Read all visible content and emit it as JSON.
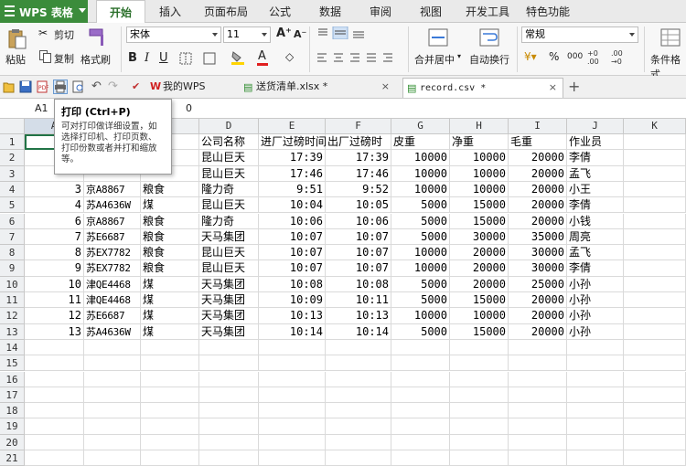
{
  "app": {
    "title": "WPS 表格"
  },
  "menu": [
    "开始",
    "插入",
    "页面布局",
    "公式",
    "数据",
    "审阅",
    "视图",
    "开发工具",
    "特色功能"
  ],
  "ribbon": {
    "paste": "粘贴",
    "cut": "剪切",
    "copy": "复制",
    "format_painter": "格式刷",
    "font_name": "宋体",
    "font_size": "11",
    "merge_center": "合并居中",
    "wrap_text": "自动换行",
    "number_format": "常规",
    "conditional_format": "条件格式",
    "bold": "B",
    "italic": "I",
    "underline": "U",
    "percent": "%",
    "comma": "000",
    "increase_font": "A⁺",
    "decrease_font": "A⁻"
  },
  "doc_tabs": [
    {
      "label": "我的WPS",
      "active": false
    },
    {
      "label": "送货清单.xlsx *",
      "active": false
    },
    {
      "label": "record.csv *",
      "active": true
    }
  ],
  "formula_bar": {
    "cell_ref": "A1",
    "value": "0"
  },
  "tooltip": {
    "title": "打印 (Ctrl+P)",
    "body": "可对打印做详细设置，如选择打印机、打印页数、打印份数或者并打和缩放等。"
  },
  "columns": [
    "A",
    "B",
    "C",
    "D",
    "E",
    "F",
    "G",
    "H",
    "I",
    "J",
    "K"
  ],
  "row_numbers": [
    "1",
    "2",
    "3",
    "4",
    "5",
    "6",
    "7",
    "8",
    "9",
    "10",
    "11",
    "12",
    "13",
    "14",
    "15",
    "16",
    "17",
    "18",
    "19",
    "20",
    "21"
  ],
  "header_row": {
    "B": "",
    "C": "",
    "D": "公司名称",
    "E": "进厂过磅时间",
    "F": "出厂过磅时",
    "G": "皮重",
    "H": "净重",
    "I": "毛重",
    "J": "作业员"
  },
  "rows": [
    {
      "A": "",
      "B": "",
      "C": "",
      "D": "昆山巨天",
      "E": "17:39",
      "F": "17:39",
      "G": "10000",
      "H": "10000",
      "I": "20000",
      "J": "李倩"
    },
    {
      "A": "",
      "B": "",
      "C": "",
      "D": "昆山巨天",
      "E": "17:46",
      "F": "17:46",
      "G": "10000",
      "H": "10000",
      "I": "20000",
      "J": "孟飞"
    },
    {
      "A": "3",
      "B": "京A8867",
      "C": "粮食",
      "D": "隆力奇",
      "E": "9:51",
      "F": "9:52",
      "G": "10000",
      "H": "10000",
      "I": "20000",
      "J": "小王"
    },
    {
      "A": "4",
      "B": "苏A4636W",
      "C": "煤",
      "D": "昆山巨天",
      "E": "10:04",
      "F": "10:05",
      "G": "5000",
      "H": "15000",
      "I": "20000",
      "J": "李倩"
    },
    {
      "A": "6",
      "B": "京A8867",
      "C": "粮食",
      "D": "隆力奇",
      "E": "10:06",
      "F": "10:06",
      "G": "5000",
      "H": "15000",
      "I": "20000",
      "J": "小钱"
    },
    {
      "A": "7",
      "B": "苏E6687",
      "C": "粮食",
      "D": "天马集团",
      "E": "10:07",
      "F": "10:07",
      "G": "5000",
      "H": "30000",
      "I": "35000",
      "J": "周亮"
    },
    {
      "A": "8",
      "B": "苏EX7782",
      "C": "粮食",
      "D": "昆山巨天",
      "E": "10:07",
      "F": "10:07",
      "G": "10000",
      "H": "20000",
      "I": "30000",
      "J": "孟飞"
    },
    {
      "A": "9",
      "B": "苏EX7782",
      "C": "粮食",
      "D": "昆山巨天",
      "E": "10:07",
      "F": "10:07",
      "G": "10000",
      "H": "20000",
      "I": "30000",
      "J": "李倩"
    },
    {
      "A": "10",
      "B": "津QE4468",
      "C": "煤",
      "D": "天马集团",
      "E": "10:08",
      "F": "10:08",
      "G": "5000",
      "H": "20000",
      "I": "25000",
      "J": "小孙"
    },
    {
      "A": "11",
      "B": "津QE4468",
      "C": "煤",
      "D": "天马集团",
      "E": "10:09",
      "F": "10:11",
      "G": "5000",
      "H": "15000",
      "I": "20000",
      "J": "小孙"
    },
    {
      "A": "12",
      "B": "苏E6687",
      "C": "煤",
      "D": "天马集团",
      "E": "10:13",
      "F": "10:13",
      "G": "10000",
      "H": "10000",
      "I": "20000",
      "J": "小孙"
    },
    {
      "A": "13",
      "B": "苏A4636W",
      "C": "煤",
      "D": "天马集团",
      "E": "10:14",
      "F": "10:14",
      "G": "5000",
      "H": "15000",
      "I": "20000",
      "J": "小孙"
    }
  ],
  "colors": {
    "accent": "#3b8c3b",
    "selection": "#217346"
  }
}
